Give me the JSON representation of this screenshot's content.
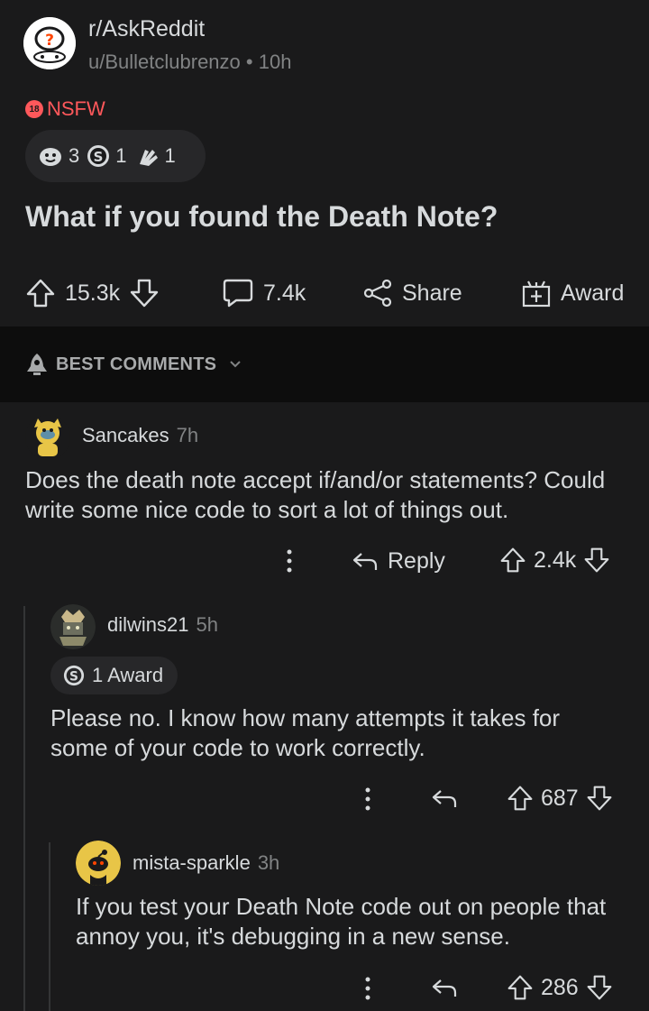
{
  "post": {
    "subreddit": "r/AskReddit",
    "author": "u/Bulletclubrenzo",
    "separator": "•",
    "age": "10h",
    "nsfw_badge_text": "18",
    "nsfw_label": "NSFW",
    "awards": [
      {
        "icon": "face-award-icon",
        "count": "3"
      },
      {
        "icon": "silver-award-icon",
        "count": "1"
      },
      {
        "icon": "clapping-award-icon",
        "count": "1"
      }
    ],
    "title": "What if you found the Death Note?",
    "upvotes": "15.3k",
    "comments": "7.4k",
    "share_label": "Share",
    "award_label": "Award"
  },
  "sort": {
    "label": "BEST COMMENTS",
    "icon": "rocket-icon"
  },
  "comments": [
    {
      "user": "Sancakes",
      "age": "7h",
      "body_line1": "Does the death note accept if/and/or statements? Could",
      "body_line2": "write some nice code to sort a lot of things out.",
      "reply_label": "Reply",
      "score": "2.4k"
    },
    {
      "user": "dilwins21",
      "age": "5h",
      "award_chip": "1 Award",
      "body_line1": "Please no. I know how many attempts it takes for",
      "body_line2": "some of your code to work correctly.",
      "score": "687"
    },
    {
      "user": "mista-sparkle",
      "age": "3h",
      "body_line1": "If you test your Death Note code out on people that",
      "body_line2": "annoy you, it's debugging in a new sense.",
      "score": "286"
    }
  ],
  "colors": {
    "background": "#1a1a1b",
    "text": "#d7dadc",
    "muted": "#818384",
    "nsfw": "#ff585b",
    "sort_bar": "#0d0d0d"
  }
}
